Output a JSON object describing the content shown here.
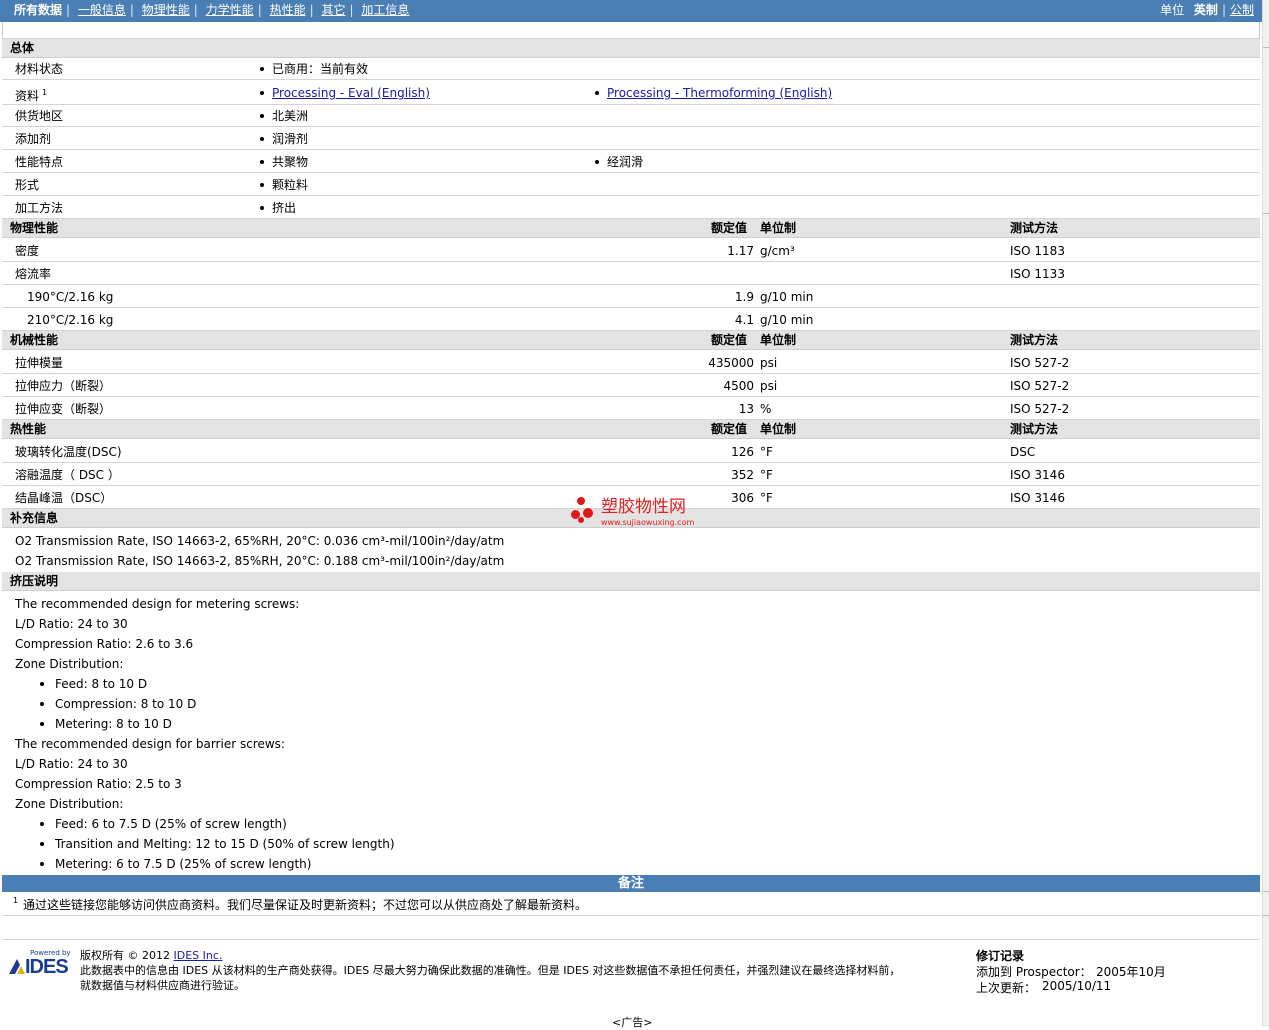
{
  "nav": {
    "all_data": "所有数据",
    "items": [
      "一般信息",
      "物理性能",
      "力学性能",
      "热性能",
      "其它",
      "加工信息"
    ],
    "unit_label": "单位",
    "unit_imperial": "英制",
    "unit_metric": "公制"
  },
  "general": {
    "title": "总体",
    "rows": [
      {
        "label": "材料状态",
        "v1": "已商用：当前有效",
        "v2": ""
      },
      {
        "label": "资料",
        "sup": "1",
        "v1": "Processing - Eval (English)",
        "v2": "Processing - Thermoforming (English)"
      },
      {
        "label": "供货地区",
        "v1": "北美洲",
        "v2": ""
      },
      {
        "label": "添加剂",
        "v1": "润滑剂",
        "v2": ""
      },
      {
        "label": "性能特点",
        "v1": "共聚物",
        "v2": "经润滑"
      },
      {
        "label": "形式",
        "v1": "颗粒料",
        "v2": ""
      },
      {
        "label": "加工方法",
        "v1": "挤出",
        "v2": ""
      }
    ]
  },
  "columns": {
    "nominal": "额定值",
    "unit": "单位制",
    "test": "测试方法"
  },
  "physical": {
    "title": "物理性能",
    "rows": [
      {
        "label": "密度",
        "value": "1.17",
        "unit": "g/cm³",
        "test": "ISO 1183"
      },
      {
        "label": "熔流率",
        "value": "",
        "unit": "",
        "test": "ISO 1133"
      },
      {
        "label": "190°C/2.16 kg",
        "value": "1.9",
        "unit": "g/10 min",
        "test": ""
      },
      {
        "label": "210°C/2.16 kg",
        "value": "4.1",
        "unit": "g/10 min",
        "test": ""
      }
    ]
  },
  "mechanical": {
    "title": "机械性能",
    "rows": [
      {
        "label": "拉伸模量",
        "value": "435000",
        "unit": "psi",
        "test": "ISO 527-2"
      },
      {
        "label": "拉伸应力（断裂）",
        "value": "4500",
        "unit": "psi",
        "test": "ISO 527-2"
      },
      {
        "label": "拉伸应变（断裂）",
        "value": "13",
        "unit": "%",
        "test": "ISO 527-2"
      }
    ]
  },
  "thermal": {
    "title": "热性能",
    "rows": [
      {
        "label": "玻璃转化温度(DSC)",
        "value": "126",
        "unit": "°F",
        "test": "DSC"
      },
      {
        "label": "溶融温度（ DSC ）",
        "value": "352",
        "unit": "°F",
        "test": "ISO 3146"
      },
      {
        "label": "结晶峰温（DSC）",
        "value": "306",
        "unit": "°F",
        "test": "ISO 3146"
      }
    ]
  },
  "supplement": {
    "title": "补充信息",
    "lines": [
      "O2 Transmission Rate, ISO 14663-2, 65%RH, 20°C: 0.036 cm³-mil/100in²/day/atm",
      "O2 Transmission Rate, ISO 14663-2, 85%RH, 20°C: 0.188 cm³-mil/100in²/day/atm"
    ]
  },
  "extrusion": {
    "title": "挤压说明",
    "metering_intro": "The recommended design for metering screws:",
    "metering_ld": "L/D Ratio: 24 to 30",
    "metering_cr": "Compression Ratio: 2.6 to 3.6",
    "zone1": "Zone Distribution:",
    "metering_zones": [
      "Feed: 8 to 10 D",
      "Compression: 8 to 10 D",
      "Metering: 8 to 10 D"
    ],
    "barrier_intro": "The recommended design for barrier screws:",
    "barrier_ld": "L/D Ratio: 24 to 30",
    "barrier_cr": "Compression Ratio: 2.5 to 3",
    "zone2": "Zone Distribution:",
    "barrier_zones": [
      "Feed: 6 to 7.5 D (25% of screw length)",
      "Transition and Melting: 12 to 15 D (50% of screw length)",
      "Metering: 6 to 7.5 D (25% of screw length)"
    ]
  },
  "notes": {
    "title": "备注",
    "sup": "1",
    "text": "通过这些链接您能够访问供应商资料。我们尽量保证及时更新资料；不过您可以从供应商处了解最新资料。"
  },
  "footer": {
    "powered_by": "Powered by",
    "logo": "IDES",
    "copyright_prefix": "版权所有 © 2012",
    "copyright_link": "IDES Inc.",
    "disclaimer_line1": "此数据表中的信息由 IDES 从该材料的生产商处获得。IDES 尽最大努力确保此数据的准确性。但是 IDES 对这些数据值不承担任何责任，并强烈建议在最终选择材料前，",
    "disclaimer_line2": "就数据值与材料供应商进行验证。",
    "rev_title": "修订记录",
    "added_label": "添加到 Prospector：",
    "added_value": "2005年10月",
    "updated_label": "上次更新：",
    "updated_value": "2005/10/11",
    "ad": "<广告>"
  },
  "watermark": {
    "text": "塑胶物性网",
    "url": "www.sujiaowuxing.com"
  }
}
